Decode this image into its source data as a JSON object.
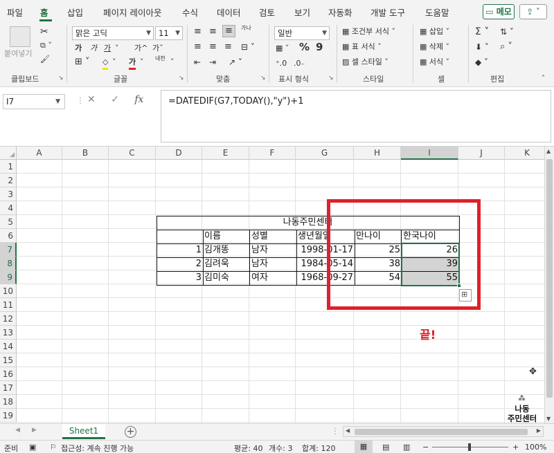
{
  "menu": {
    "tabs": [
      "파일",
      "홈",
      "삽입",
      "페이지 레이아웃",
      "수식",
      "데이터",
      "검토",
      "보기",
      "자동화",
      "개발 도구",
      "도움말"
    ],
    "memo": "메모",
    "share_icon": "share-icon"
  },
  "ribbon": {
    "clipboard": {
      "paste": "붙여넣기",
      "label": "클립보드"
    },
    "font": {
      "name": "맑은 고딕",
      "size": "11",
      "bold": "가",
      "italic": "가",
      "underline": "가",
      "grow": "가^",
      "shrink": "가ˇ",
      "phonetic": "내천",
      "label": "글꼴"
    },
    "align": {
      "wrap": "가나",
      "label": "맞춤"
    },
    "number": {
      "format": "일반",
      "percent": "%",
      "comma": "9",
      "label": "표시 형식"
    },
    "styles": {
      "conditional": "조건부 서식",
      "table": "표 서식",
      "cell": "셀 스타일",
      "label": "스타일"
    },
    "cells": {
      "insert": "삽입",
      "delete": "삭제",
      "format": "서식",
      "label": "셀"
    },
    "editing": {
      "label": "편집"
    }
  },
  "formula": {
    "name_box": "I7",
    "fx": "fx",
    "content": "=DATEDIF(G7,TODAY(),\"y\")+1"
  },
  "grid": {
    "columns": [
      "A",
      "B",
      "C",
      "D",
      "E",
      "F",
      "G",
      "H",
      "I",
      "J",
      "K"
    ],
    "selected_column": "I",
    "rows": [
      "1",
      "2",
      "3",
      "4",
      "5",
      "6",
      "7",
      "8",
      "9",
      "10",
      "11",
      "12",
      "13",
      "14",
      "15",
      "16",
      "17",
      "18",
      "19"
    ],
    "selected_rows": [
      "7",
      "8",
      "9"
    ],
    "table_title": "나동주민센터",
    "headers": [
      "이름",
      "성별",
      "생년월일",
      "만나이",
      "한국나이"
    ],
    "records": [
      {
        "no": "1",
        "name": "김개똥",
        "gender": "남자",
        "birth": "1998-01-17",
        "age": "25",
        "korean_age": "26"
      },
      {
        "no": "2",
        "name": "김려욱",
        "gender": "남자",
        "birth": "1984-05-14",
        "age": "38",
        "korean_age": "39"
      },
      {
        "no": "3",
        "name": "김미숙",
        "gender": "여자",
        "birth": "1968-09-27",
        "age": "54",
        "korean_age": "55"
      }
    ]
  },
  "annotation": {
    "done": "끝!",
    "watermark_line1": "나동",
    "watermark_line2": "주민센터",
    "highlight_color": "#e0202a"
  },
  "sheets": {
    "active": "Sheet1"
  },
  "status": {
    "ready": "준비",
    "accessibility": "접근성: 계속 진행 가능",
    "average": "평균: 40",
    "count": "개수: 3",
    "sum": "합계: 120",
    "zoom": "100%"
  },
  "colors": {
    "accent": "#217346",
    "selection": "#d3d3d3"
  }
}
